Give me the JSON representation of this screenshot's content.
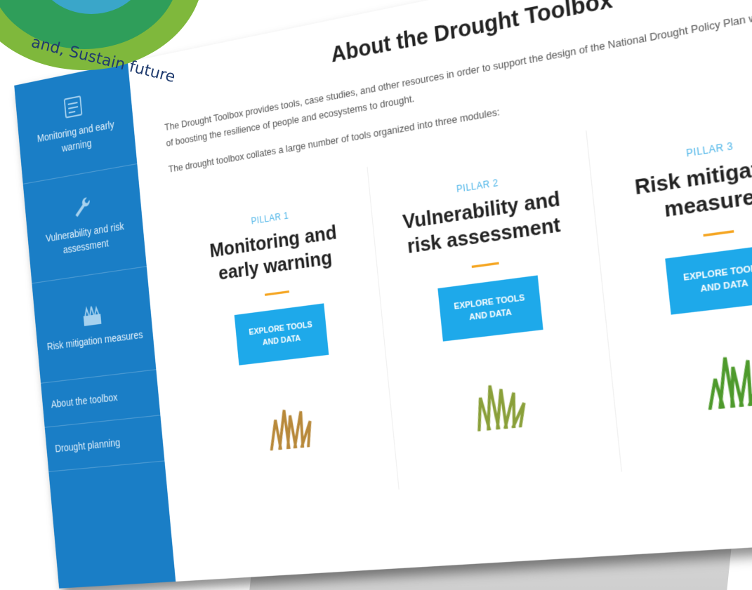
{
  "logo": {
    "tagline": "and, Sustain future"
  },
  "sidebar": {
    "items": [
      {
        "label": "Monitoring and early warning",
        "icon": "monitor-icon"
      },
      {
        "label": "Vulnerability and risk assessment",
        "icon": "wrench-icon"
      },
      {
        "label": "Risk mitigation measures",
        "icon": "field-icon"
      },
      {
        "label": "About the toolbox"
      },
      {
        "label": "Drought planning"
      }
    ]
  },
  "main": {
    "title": "About the Drought Toolbox",
    "intro": "The Drought Toolbox provides tools, case studies, and other resources in order to support the design of the National Drought Policy Plan with the aim of boosting the resilience of people and ecosystems to drought.",
    "modules_note": "The drought toolbox collates a large number of tools organized into three modules:",
    "pillars": [
      {
        "tag": "PILLAR 1",
        "title": "Monitoring and early warning",
        "button": "EXPLORE TOOLS AND DATA",
        "grass_color": "#b8893a"
      },
      {
        "tag": "PILLAR 2",
        "title": "Vulnerability and risk assessment",
        "button": "EXPLORE TOOLS AND DATA",
        "grass_color": "#8aa03a"
      },
      {
        "tag": "PILLAR 3",
        "title": "Risk mitigation measures",
        "button": "EXPLORE TOOLS AND DATA",
        "grass_color": "#4e9a2c"
      }
    ]
  },
  "colors": {
    "sidebar": "#1a7ec6",
    "button": "#1ea9ea",
    "accent_dash": "#f5a623",
    "pillar_tag": "#4db5e8"
  }
}
